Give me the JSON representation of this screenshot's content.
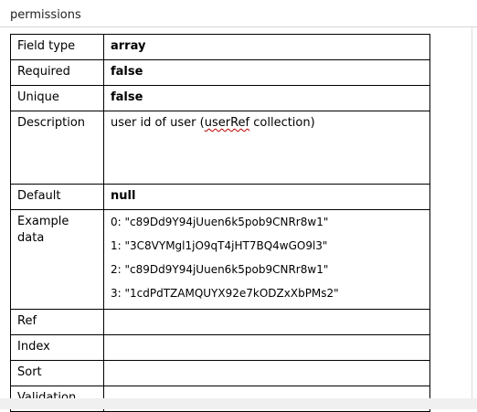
{
  "header": {
    "title": "permissions"
  },
  "table": {
    "rows": [
      {
        "label": "Field type",
        "value": "array",
        "bold": true
      },
      {
        "label": "Required",
        "value": "false",
        "bold": true
      },
      {
        "label": "Unique",
        "value": "false",
        "bold": true
      },
      {
        "label": "Description",
        "value_before": "user id of user (",
        "value_link": "userRef",
        "value_after": " collection)"
      },
      {
        "label": "Default",
        "value": "null",
        "bold": true
      },
      {
        "label": "Example data",
        "examples": [
          "0: \"c89Dd9Y94jUuen6k5pob9CNRr8w1\"",
          "1: \"3C8VYMgl1jO9qT4jHT7BQ4wGO9l3\"",
          "2: \"c89Dd9Y94jUuen6k5pob9CNRr8w1\"",
          "3: \"1cdPdTZAMQUYX92e7kODZxXbPMs2\""
        ]
      },
      {
        "label": "Ref",
        "value": ""
      },
      {
        "label": "Index",
        "value": ""
      },
      {
        "label": "Sort",
        "value": ""
      },
      {
        "label": "Validation",
        "value": ""
      }
    ]
  }
}
